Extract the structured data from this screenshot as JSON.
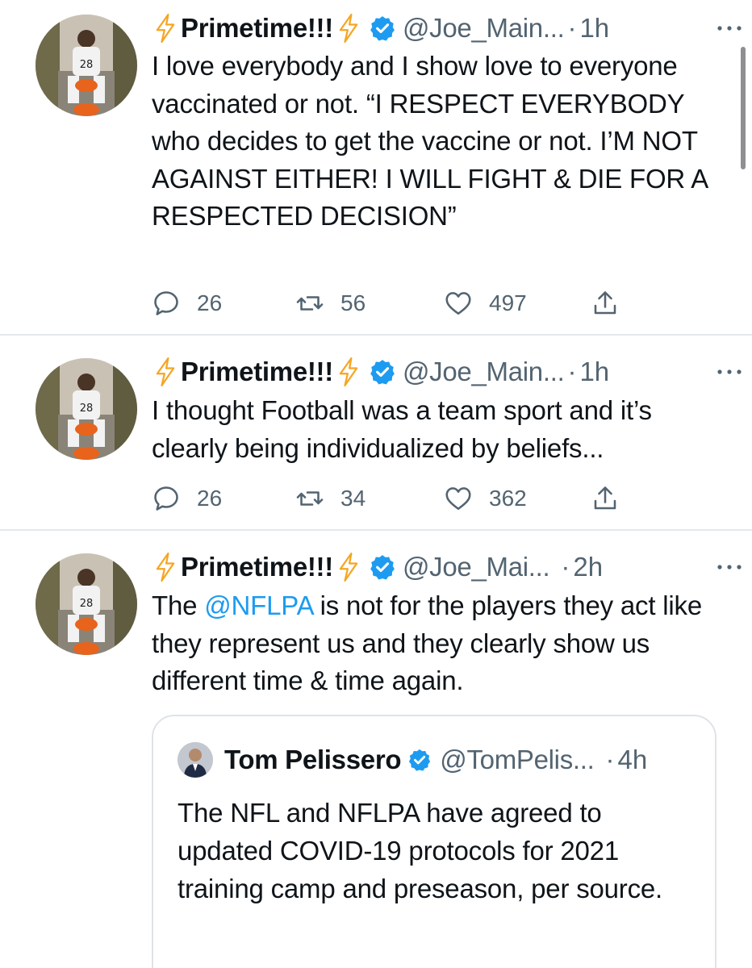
{
  "tweets": [
    {
      "name": "Primetime!!!",
      "handle": "@Joe_Main...",
      "time": "1h",
      "text": "I love everybody and I show love to everyone vaccinated or not. “I RESPECT EVERYBODY who decides to get the vaccine or not. I’M NOT AGAINST EITHER! I WILL FIGHT & DIE FOR A RESPECTED DECISION”",
      "replies": "26",
      "retweets": "56",
      "likes": "497"
    },
    {
      "name": "Primetime!!!",
      "handle": "@Joe_Main...",
      "time": "1h",
      "text": "I thought Football was a team sport and it’s clearly being individualized by beliefs...",
      "replies": "26",
      "retweets": "34",
      "likes": "362"
    },
    {
      "name": "Primetime!!!",
      "handle": "@Joe_Mai...",
      "time": "2h",
      "text_before": "The ",
      "mention": "@NFLPA",
      "text_after": " is not for the players they act like they represent us and they clearly show us different time & time again.",
      "quote": {
        "name": "Tom Pelissero",
        "handle": "@TomPelis...",
        "time": "4h",
        "text": "The NFL and NFLPA have agreed to updated COVID-19 protocols for 2021 training camp and preseason, per source."
      }
    }
  ],
  "separator": "·",
  "icons": {
    "verified": "verified-badge-icon",
    "bolt": "lightning-bolt-icon",
    "reply": "reply-icon",
    "retweet": "retweet-icon",
    "like": "heart-icon",
    "share": "share-icon",
    "more": "more-options-icon"
  },
  "colors": {
    "accent": "#1d9bf0",
    "bolt": "#f5a623",
    "secondary_text": "#536471"
  }
}
